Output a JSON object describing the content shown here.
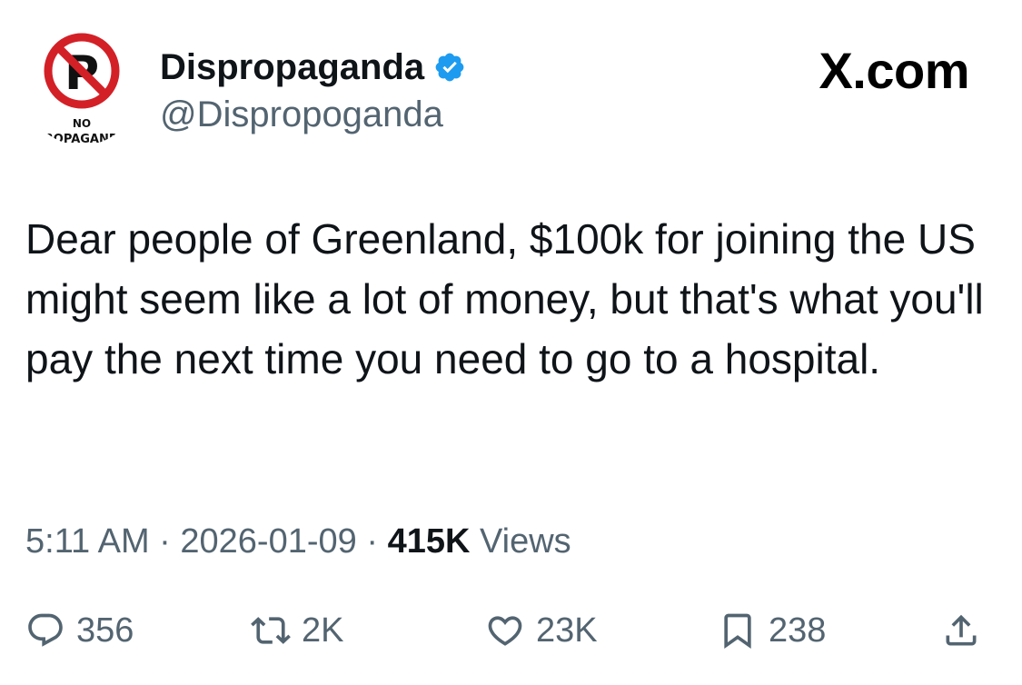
{
  "author": {
    "display_name": "Dispropaganda",
    "handle": "@Dispropoganda",
    "avatar_caption": "NO PROPAGANDA"
  },
  "brand": "X.com",
  "tweet": {
    "text": "Dear people of Greenland, $100k for joining the US might seem like a lot of money, but that's what you'll pay the next time you need to go to a hospital."
  },
  "meta": {
    "time": "5:11 AM",
    "separator": "·",
    "date": "2026-01-09",
    "views_count": "415K",
    "views_label": "Views"
  },
  "actions": {
    "replies": "356",
    "reposts": "2K",
    "likes": "23K",
    "bookmarks": "238"
  },
  "colors": {
    "text_primary": "#0f1419",
    "text_secondary": "#536471",
    "verified_blue": "#1d9bf0",
    "avatar_red": "#d32027"
  },
  "icons": [
    "verified-badge-icon",
    "reply-icon",
    "repost-icon",
    "like-icon",
    "bookmark-icon",
    "share-icon"
  ]
}
